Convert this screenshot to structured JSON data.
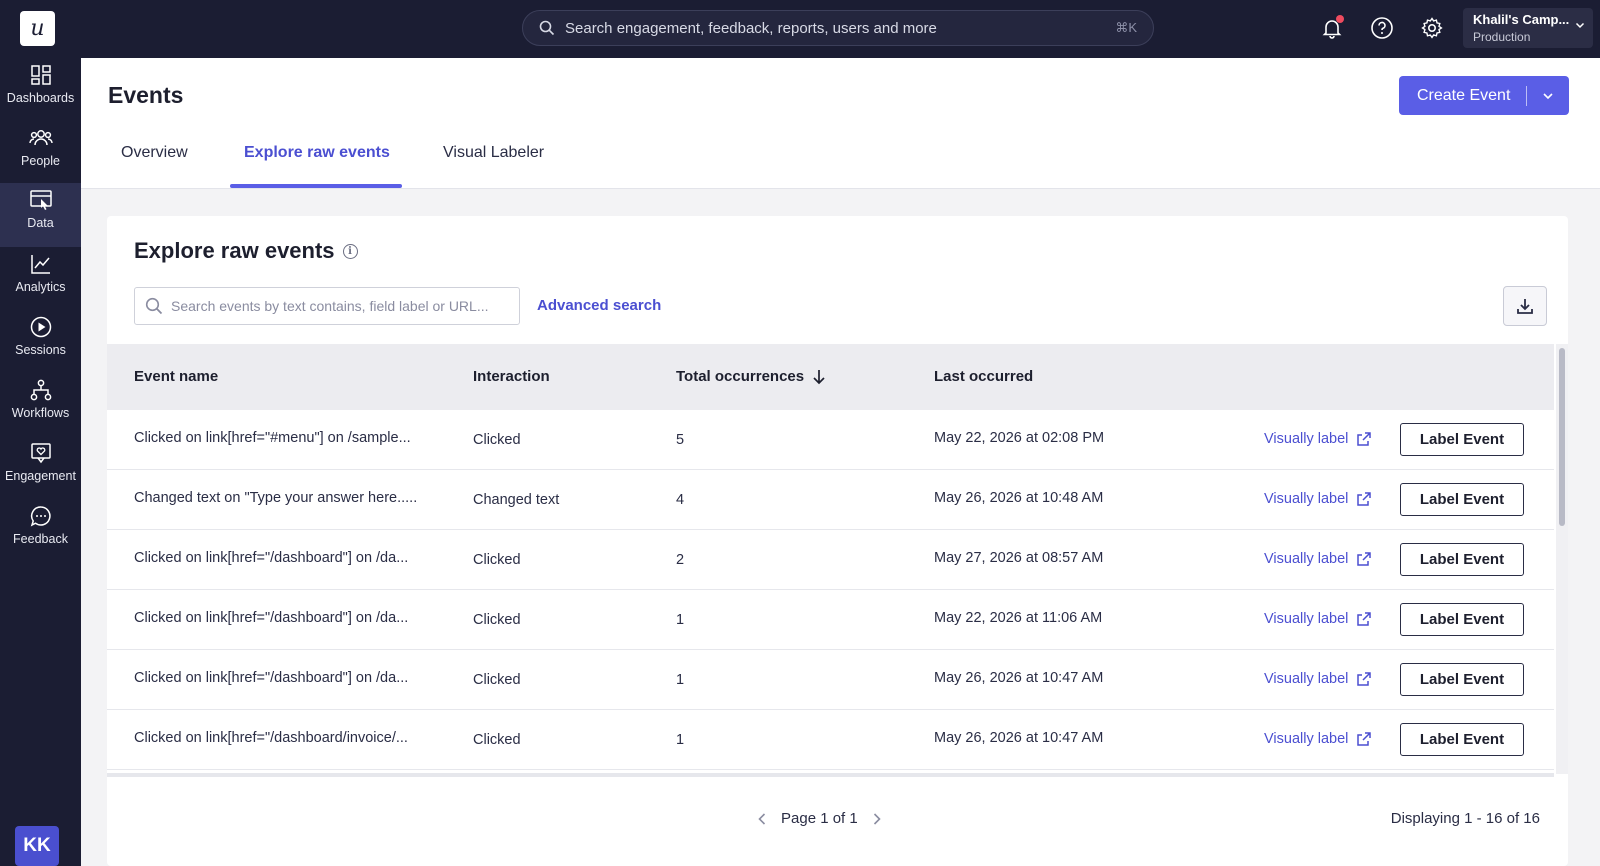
{
  "app": {
    "logo_letter": "u",
    "search_placeholder": "Search engagement, feedback, reports, users and more",
    "search_shortcut": "⌘K",
    "account_name": "Khalil's Camp...",
    "account_env": "Production",
    "avatar_initials": "KK"
  },
  "sidebar": {
    "items": [
      {
        "label": "Dashboards",
        "icon": "dashboard-icon"
      },
      {
        "label": "People",
        "icon": "people-icon"
      },
      {
        "label": "Data",
        "icon": "data-icon"
      },
      {
        "label": "Analytics",
        "icon": "analytics-icon"
      },
      {
        "label": "Sessions",
        "icon": "play-icon"
      },
      {
        "label": "Workflows",
        "icon": "workflow-icon"
      },
      {
        "label": "Engagement",
        "icon": "engagement-icon"
      },
      {
        "label": "Feedback",
        "icon": "feedback-icon"
      }
    ],
    "active": "Data"
  },
  "header": {
    "title": "Events",
    "create_button": "Create Event",
    "tabs": [
      {
        "label": "Overview"
      },
      {
        "label": "Explore raw events"
      },
      {
        "label": "Visual Labeler"
      }
    ],
    "active_tab": "Explore raw events"
  },
  "card": {
    "title": "Explore raw events",
    "search_placeholder": "Search events by text contains, field label or URL...",
    "advanced_search": "Advanced search",
    "columns": {
      "event_name": "Event name",
      "interaction": "Interaction",
      "total": "Total occurrences",
      "last": "Last occurred"
    },
    "rows": [
      {
        "name": "Clicked on link[href=\"#menu\"] on /sample...",
        "interaction": "Clicked",
        "total": "5",
        "last": "May 22, 2026 at 02:08 PM",
        "visual": "Visually label",
        "action": "Label Event"
      },
      {
        "name": "Changed text on \"Type your answer here.....",
        "interaction": "Changed text",
        "total": "4",
        "last": "May 26, 2026 at 10:48 AM",
        "visual": "Visually label",
        "action": "Label Event"
      },
      {
        "name": "Clicked on link[href=\"/dashboard\"] on /da...",
        "interaction": "Clicked",
        "total": "2",
        "last": "May 27, 2026 at 08:57 AM",
        "visual": "Visually label",
        "action": "Label Event"
      },
      {
        "name": "Clicked on link[href=\"/dashboard\"] on /da...",
        "interaction": "Clicked",
        "total": "1",
        "last": "May 22, 2026 at 11:06 AM",
        "visual": "Visually label",
        "action": "Label Event"
      },
      {
        "name": "Clicked on link[href=\"/dashboard\"] on /da...",
        "interaction": "Clicked",
        "total": "1",
        "last": "May 26, 2026 at 10:47 AM",
        "visual": "Visually label",
        "action": "Label Event"
      },
      {
        "name": "Clicked on link[href=\"/dashboard/invoice/...",
        "interaction": "Clicked",
        "total": "1",
        "last": "May 26, 2026 at 10:47 AM",
        "visual": "Visually label",
        "action": "Label Event"
      }
    ],
    "pagination": "Page 1 of 1",
    "displaying": "Displaying 1 - 16 of 16"
  },
  "colors": {
    "nav_bg": "#1b1d33",
    "accent": "#5a5ee6",
    "link": "#4b4fd1",
    "notification": "#ef4b5f"
  }
}
